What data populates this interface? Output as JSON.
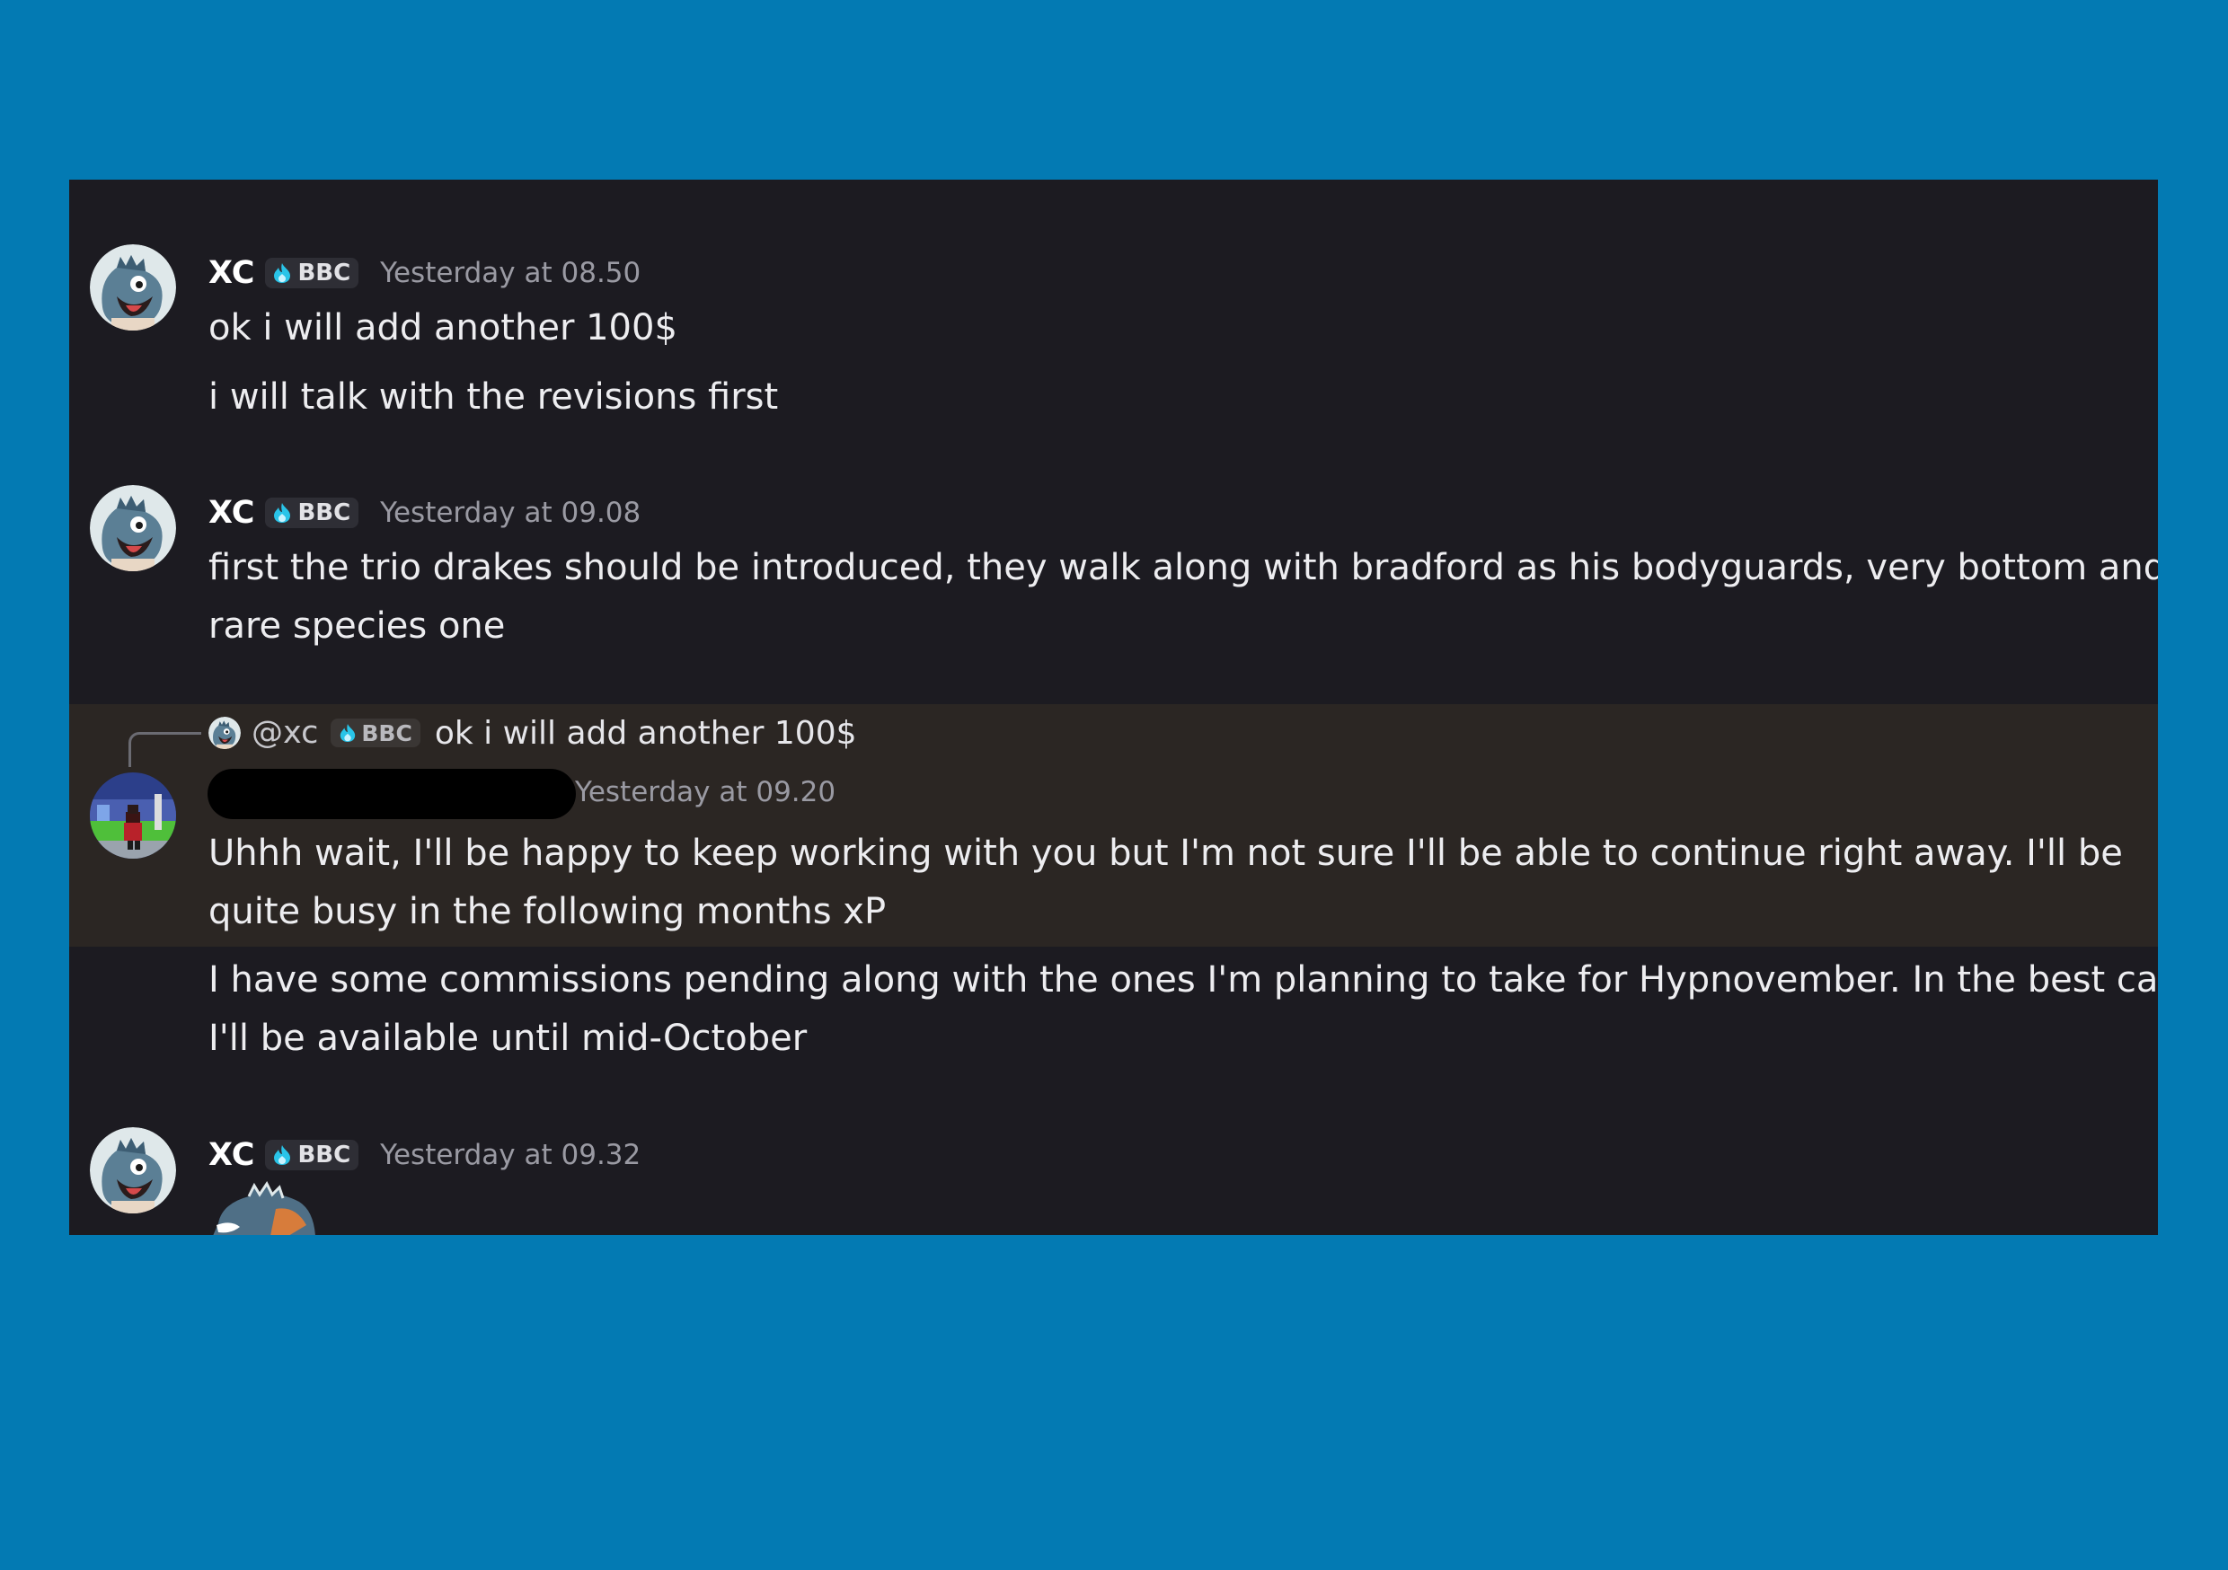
{
  "messages": [
    {
      "username": "XC",
      "tag": "BBC",
      "timestamp": "Yesterday at 08.50",
      "lines": [
        "ok i will add another 100$",
        "i will talk with the revisions first"
      ]
    },
    {
      "username": "XC",
      "tag": "BBC",
      "timestamp": "Yesterday at 09.08",
      "lines": [
        "first the trio drakes should be introduced, they walk along with bradford as his bodyguards, very bottom and",
        "rare species one"
      ]
    },
    {
      "reply": {
        "mention": "@xc",
        "tag": "BBC",
        "text": "ok i will add another 100$"
      },
      "timestamp": "Yesterday at 09.20",
      "lines": [
        "Uhhh wait, I'll be happy to keep working with you but I'm not sure I'll be able to continue right away. I'll be",
        "quite busy in the following months xP",
        "I have some commissions pending along with the ones I'm planning to take for Hypnovember. In the best case",
        "I'll be available until mid-October"
      ]
    },
    {
      "username": "XC",
      "tag": "BBC",
      "timestamp": "Yesterday at 09.32"
    }
  ],
  "colors": {
    "page_bg": "#037ab3",
    "panel_bg": "#1c1b21",
    "highlight_bg": "#2b2623",
    "tag_flame": "#29c4e8"
  },
  "icons": [
    "dragon-avatar-icon",
    "artist-avatar-icon",
    "flame-badge-icon",
    "dragon-sticker-icon"
  ]
}
